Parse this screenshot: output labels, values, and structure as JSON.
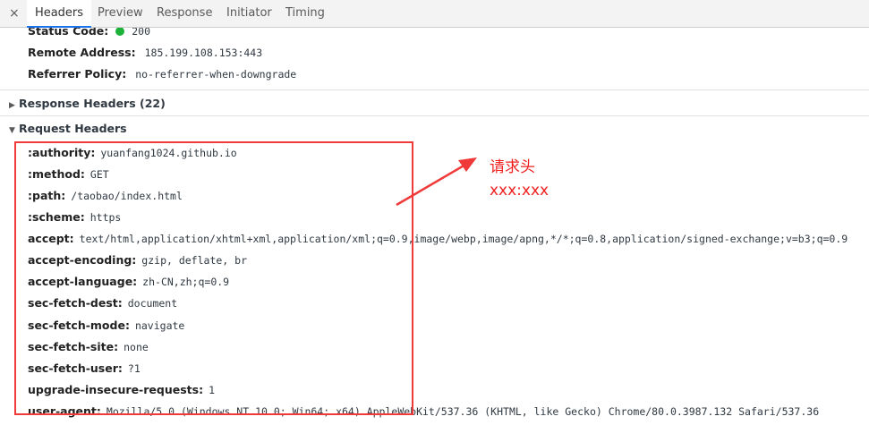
{
  "tabs": {
    "close": "×",
    "items": [
      "Headers",
      "Preview",
      "Response",
      "Initiator",
      "Timing"
    ],
    "active": "Headers"
  },
  "general": {
    "status_code_key": "Status Code:",
    "status_code_value": "200",
    "remote_address_key": "Remote Address:",
    "remote_address_value": "185.199.108.153:443",
    "referrer_policy_key": "Referrer Policy:",
    "referrer_policy_value": "no-referrer-when-downgrade"
  },
  "response_headers": {
    "label": "Response Headers (22)",
    "collapsed": true
  },
  "request_headers": {
    "label": "Request Headers",
    "items": [
      {
        "key": ":authority:",
        "value": "yuanfang1024.github.io"
      },
      {
        "key": ":method:",
        "value": "GET"
      },
      {
        "key": ":path:",
        "value": "/taobao/index.html"
      },
      {
        "key": ":scheme:",
        "value": "https"
      },
      {
        "key": "accept:",
        "value": "text/html,application/xhtml+xml,application/xml;q=0.9,image/webp,image/apng,*/*;q=0.8,application/signed-exchange;v=b3;q=0.9"
      },
      {
        "key": "accept-encoding:",
        "value": "gzip, deflate, br"
      },
      {
        "key": "accept-language:",
        "value": "zh-CN,zh;q=0.9"
      },
      {
        "key": "sec-fetch-dest:",
        "value": "document"
      },
      {
        "key": "sec-fetch-mode:",
        "value": "navigate"
      },
      {
        "key": "sec-fetch-site:",
        "value": "none"
      },
      {
        "key": "sec-fetch-user:",
        "value": "?1"
      },
      {
        "key": "upgrade-insecure-requests:",
        "value": "1"
      },
      {
        "key": "user-agent:",
        "value": "Mozilla/5.0 (Windows NT 10.0; Win64; x64) AppleWebKit/537.36 (KHTML, like Gecko) Chrome/80.0.3987.132 Safari/537.36"
      }
    ]
  },
  "annotation": {
    "title": "请求头",
    "subtitle": "xxx:xxx",
    "color": "#f02020"
  },
  "colors": {
    "status_ok": "#1db33a",
    "highlight_box": "#f03a3a",
    "active_tab_underline": "#1a73e8"
  }
}
